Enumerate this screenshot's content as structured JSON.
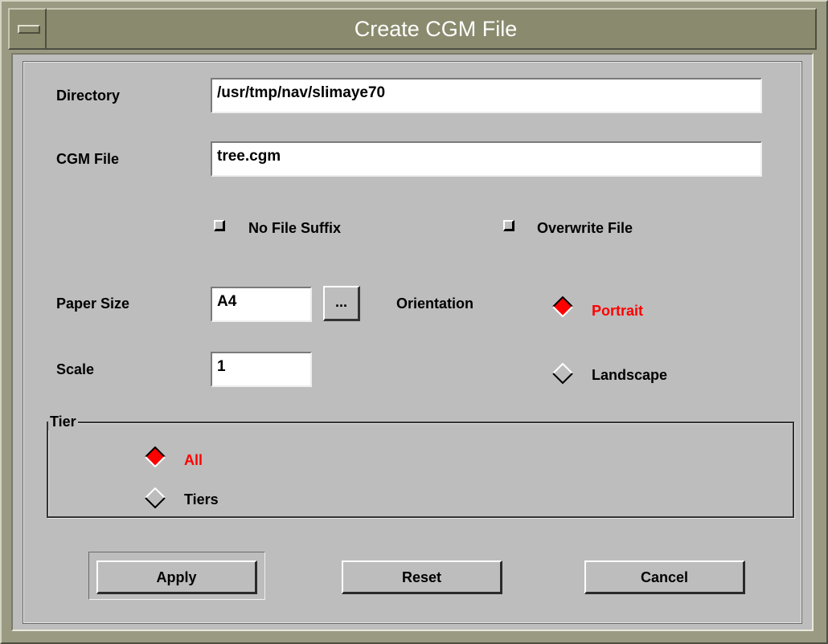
{
  "window": {
    "title": "Create CGM File"
  },
  "form": {
    "directory_label": "Directory",
    "directory_value": "/usr/tmp/nav/slimaye70",
    "cgm_file_label": "CGM File",
    "cgm_file_value": "tree.cgm",
    "no_file_suffix_label": "No File Suffix",
    "overwrite_file_label": "Overwrite File",
    "paper_size_label": "Paper Size",
    "paper_size_value": "A4",
    "browse_label": "...",
    "orientation_label": "Orientation",
    "portrait_label": "Portrait",
    "landscape_label": "Landscape",
    "scale_label": "Scale",
    "scale_value": "1",
    "orientation_selected": "Portrait"
  },
  "tier": {
    "title": "Tier",
    "all_label": "All",
    "tiers_label": "Tiers",
    "selected": "All"
  },
  "buttons": {
    "apply": "Apply",
    "reset": "Reset",
    "cancel": "Cancel"
  },
  "colors": {
    "selected_radio": "#ff0000",
    "frame": "#9a9a82",
    "background": "#bdbdbd"
  }
}
